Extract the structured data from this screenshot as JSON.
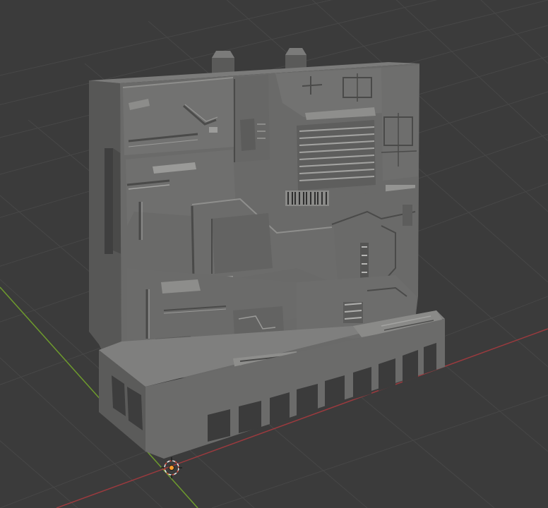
{
  "viewport": {
    "background": "#3b3b3b",
    "grid_color": "#474747",
    "x_axis_color": "#9b3a3e",
    "y_axis_color": "#6e9b2d",
    "cursor_color": "#e8e8e8",
    "origin_color": "#ff9c2a"
  },
  "model": {
    "body_color": "#6a6a69",
    "side_color": "#5a5a59",
    "top_color": "#7b7b7a",
    "shadow_color": "#404040",
    "highlight_color": "#9a9a98"
  }
}
